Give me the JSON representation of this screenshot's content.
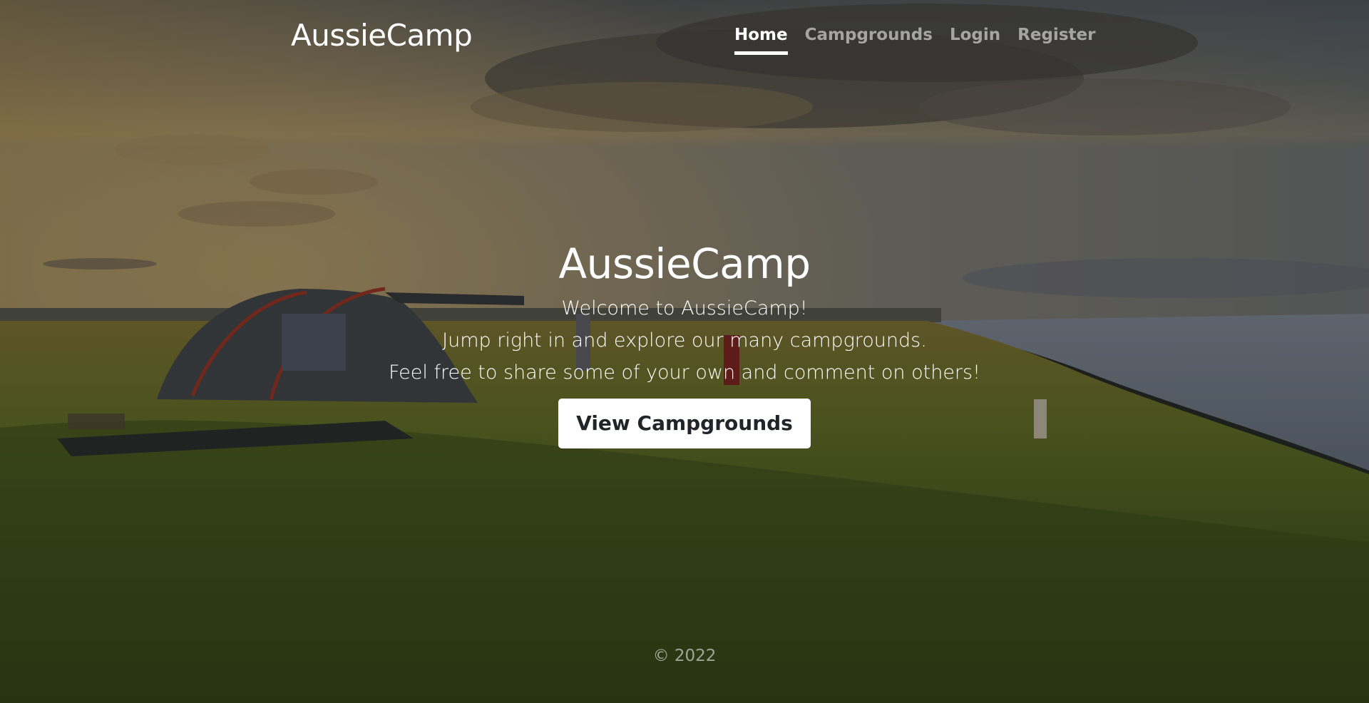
{
  "header": {
    "brand": "AussieCamp",
    "nav": [
      {
        "label": "Home",
        "active": true
      },
      {
        "label": "Campgrounds",
        "active": false
      },
      {
        "label": "Login",
        "active": false
      },
      {
        "label": "Register",
        "active": false
      }
    ]
  },
  "main": {
    "title": "AussieCamp",
    "lead_lines": [
      "Welcome to AussieCamp!",
      "Jump right in and explore our many campgrounds.",
      "Feel free to share some of your own and comment on others!"
    ],
    "cta_label": "View Campgrounds"
  },
  "footer": {
    "copyright": "© 2022"
  },
  "colors": {
    "text_primary": "#ffffff",
    "nav_muted": "rgba(255,255,255,0.55)",
    "button_bg": "#ffffff",
    "button_text": "#212529"
  }
}
